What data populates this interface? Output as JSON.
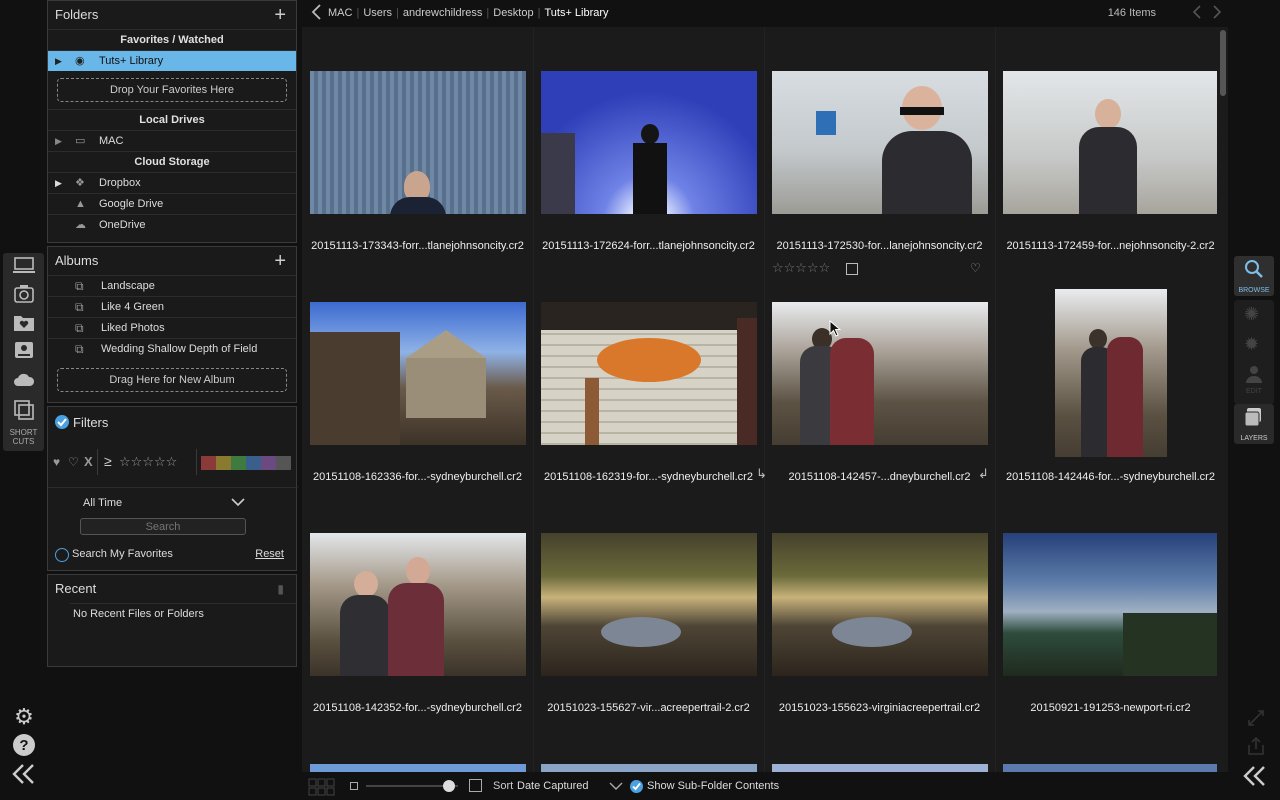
{
  "left_rail": {
    "shortcuts_label_1": "SHORT",
    "shortcuts_label_2": "CUTS"
  },
  "folders": {
    "title": "Folders",
    "favorites_section": "Favorites / Watched",
    "favorite_item": "Tuts+ Library",
    "drop_favorites": "Drop Your Favorites Here",
    "local_section": "Local Drives",
    "local_item": "MAC",
    "cloud_section": "Cloud Storage",
    "cloud_items": [
      "Dropbox",
      "Google Drive",
      "OneDrive"
    ]
  },
  "albums": {
    "title": "Albums",
    "items": [
      "Landscape",
      "Like 4 Green",
      "Liked Photos",
      "Wedding Shallow Depth of Field"
    ],
    "drag_here": "Drag Here for New Album"
  },
  "filters": {
    "title": "Filters",
    "x_label": "X",
    "rating_prefix": "≥",
    "time_filter": "All Time",
    "search_placeholder": "Search",
    "search_favorites": "Search My Favorites",
    "reset": "Reset",
    "color_labels": [
      "#8b3a3a",
      "#8a7a30",
      "#3f7a3f",
      "#3a5f8c",
      "#6a4a80",
      "#555555"
    ]
  },
  "recent": {
    "title": "Recent",
    "empty": "No Recent Files or Folders"
  },
  "breadcrumb": {
    "parts": [
      "MAC",
      "Users",
      "andrewchildress",
      "Desktop",
      "Tuts+ Library"
    ],
    "item_count": "146 Items"
  },
  "thumbnails": [
    {
      "name": "20151113-173343-forr...tlanejohnsoncity.cr2"
    },
    {
      "name": "20151113-172624-forr...tlanejohnsoncity.cr2"
    },
    {
      "name": "20151113-172530-for...lanejohnsoncity.cr2"
    },
    {
      "name": "20151113-172459-for...nejohnsoncity-2.cr2"
    },
    {
      "name": "20151108-162336-for...-sydneyburchell.cr2"
    },
    {
      "name": "20151108-162319-for...-sydneyburchell.cr2"
    },
    {
      "name": "20151108-142457-...dneyburchell.cr2"
    },
    {
      "name": "20151108-142446-for...-sydneyburchell.cr2"
    },
    {
      "name": "20151108-142352-for...-sydneyburchell.cr2"
    },
    {
      "name": "20151023-155627-vir...acreepertrail-2.cr2"
    },
    {
      "name": "20151023-155623-virginiacreepertrail.cr2"
    },
    {
      "name": "20150921-191253-newport-ri.cr2"
    }
  ],
  "bottombar": {
    "sort_label": "Sort",
    "sort_value": "Date Captured",
    "show_subfolders": "Show Sub-Folder Contents",
    "thumb_size_percent": 90
  },
  "right_rail": {
    "browse": "BROWSE",
    "edit": "EDIT",
    "layers": "LAYERS"
  },
  "colors": {
    "selection": "#69b7e8",
    "accent_check": "#4aa0e0"
  }
}
